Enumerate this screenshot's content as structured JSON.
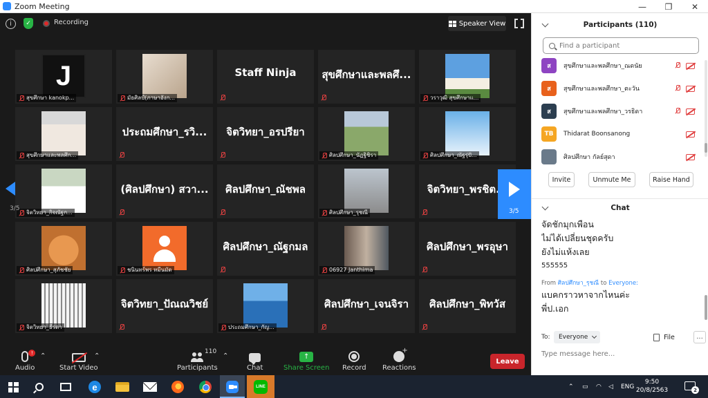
{
  "window": {
    "title": "Zoom Meeting",
    "minimize": "—",
    "maximize": "❐",
    "close": "✕"
  },
  "topbar": {
    "recording_label": "Recording",
    "speaker_view_label": "Speaker View"
  },
  "gallery": {
    "page_indicator": "3/5",
    "tiles": [
      {
        "name": "สุขศึกษา kanokp...",
        "type": "video",
        "thumb": "j",
        "thumb_letter": "J"
      },
      {
        "name": "มัธศิลป์(ภาษาอังก...",
        "type": "video",
        "thumb": "girls"
      },
      {
        "name": "Staff Ninja",
        "type": "text"
      },
      {
        "name": "สุขศึกษาและพลศึ...",
        "type": "text"
      },
      {
        "name": "วราวุฒิ สุขศึกษาแ...",
        "type": "video",
        "thumb": "building"
      },
      {
        "name": "สุขศึกษาและพลศึก...",
        "type": "video",
        "thumb": "boy"
      },
      {
        "name": "ประถมศึกษา_รวิ...",
        "type": "text"
      },
      {
        "name": "จิตวิทยา_อรปรียา",
        "type": "text"
      },
      {
        "name": "ศิลปศึกษา_นัฏฐิชิรา",
        "type": "video",
        "thumb": "field"
      },
      {
        "name": "ศิลปศึกษา_ณัฐรุ่ปั...",
        "type": "video",
        "thumb": "clouds"
      },
      {
        "name": "จิตวิทยา_กิจณัฐก...",
        "type": "video",
        "thumb": "student"
      },
      {
        "name": "(ศิลปศึกษา) สวา...",
        "type": "text"
      },
      {
        "name": "ศิลปศึกษา_ณัชพล",
        "type": "text"
      },
      {
        "name": "ศิลปศึกษา_รุชณี",
        "type": "video",
        "thumb": "lady"
      },
      {
        "name": "จิตวิทยา_พรชิต...",
        "type": "text"
      },
      {
        "name": "ศิลปศึกษา_สุภัชชัย",
        "type": "video",
        "thumb": "cat"
      },
      {
        "name": "ชนินทร์พร หมีนมัด",
        "type": "video",
        "thumb": "avatar"
      },
      {
        "name": "ศิลปศึกษา_ณัฐกมล",
        "type": "text"
      },
      {
        "name": "06927 Janthima",
        "type": "video",
        "thumb": "street"
      },
      {
        "name": "ศิลปศึกษา_พรอุษา",
        "type": "text"
      },
      {
        "name": "จิตวิทยา_ธีรดา",
        "type": "video",
        "thumb": "fence"
      },
      {
        "name": "จิตวิทยา_ปัณณวิชย์",
        "type": "text"
      },
      {
        "name": "ประถมศึกษา_กัญ...",
        "type": "video",
        "thumb": "sea"
      },
      {
        "name": "ศิลปศึกษา_เจนจิรา",
        "type": "text"
      },
      {
        "name": "ศิลปศึกษา_พิทวัส",
        "type": "text"
      }
    ]
  },
  "toolbar": {
    "audio_label": "Audio",
    "audio_badge": "!",
    "video_label": "Start Video",
    "participants_label": "Participants",
    "participants_count": "110",
    "chat_label": "Chat",
    "share_label": "Share Screen",
    "record_label": "Record",
    "reactions_label": "Reactions",
    "leave_label": "Leave"
  },
  "participants_panel": {
    "title": "Participants (110)",
    "search_placeholder": "Find a participant",
    "items": [
      {
        "initial": "ส",
        "color": "#8e44c2",
        "name": "สุขศึกษาและพลศึกษา_ณดนัย"
      },
      {
        "initial": "ส",
        "color": "#e8611c",
        "name": "สุขศึกษาและพลศึกษา_ตะวัน"
      },
      {
        "initial": "ส",
        "color": "#2c3e50",
        "name": "สุขศึกษาและพลศึกษา_วรธิดา"
      },
      {
        "initial": "TB",
        "color": "#f5a623",
        "name": "Thidarat Boonsanong"
      },
      {
        "initial": "",
        "color": "#6a7a8a",
        "name": "ศิลปศึกษา กัลย์สุดา"
      }
    ],
    "invite_label": "Invite",
    "unmute_label": "Unmute Me",
    "raise_hand_label": "Raise Hand"
  },
  "chat_panel": {
    "title": "Chat",
    "messages": [
      "จัดชักมุกเพือน",
      "ไม่ได้เปลี่ยนชุดครับ",
      "ยังไม่แห้งเลย",
      "555555"
    ],
    "from_prefix": "From",
    "from_name": "ศิลปศึกษา_รุชณี",
    "from_to": "to",
    "from_target": "Everyone:",
    "messages2": [
      "แบคกราวหาจากไหนค่ะ",
      "พี่ป.เอก"
    ],
    "to_label": "To:",
    "to_value": "Everyone",
    "file_label": "File",
    "more_label": "...",
    "input_placeholder": "Type message here..."
  },
  "taskbar": {
    "lang": "ENG",
    "time": "9:50",
    "date": "20/8/2563",
    "notif_count": "2",
    "line_label": "LINE",
    "edge_label": "e"
  }
}
